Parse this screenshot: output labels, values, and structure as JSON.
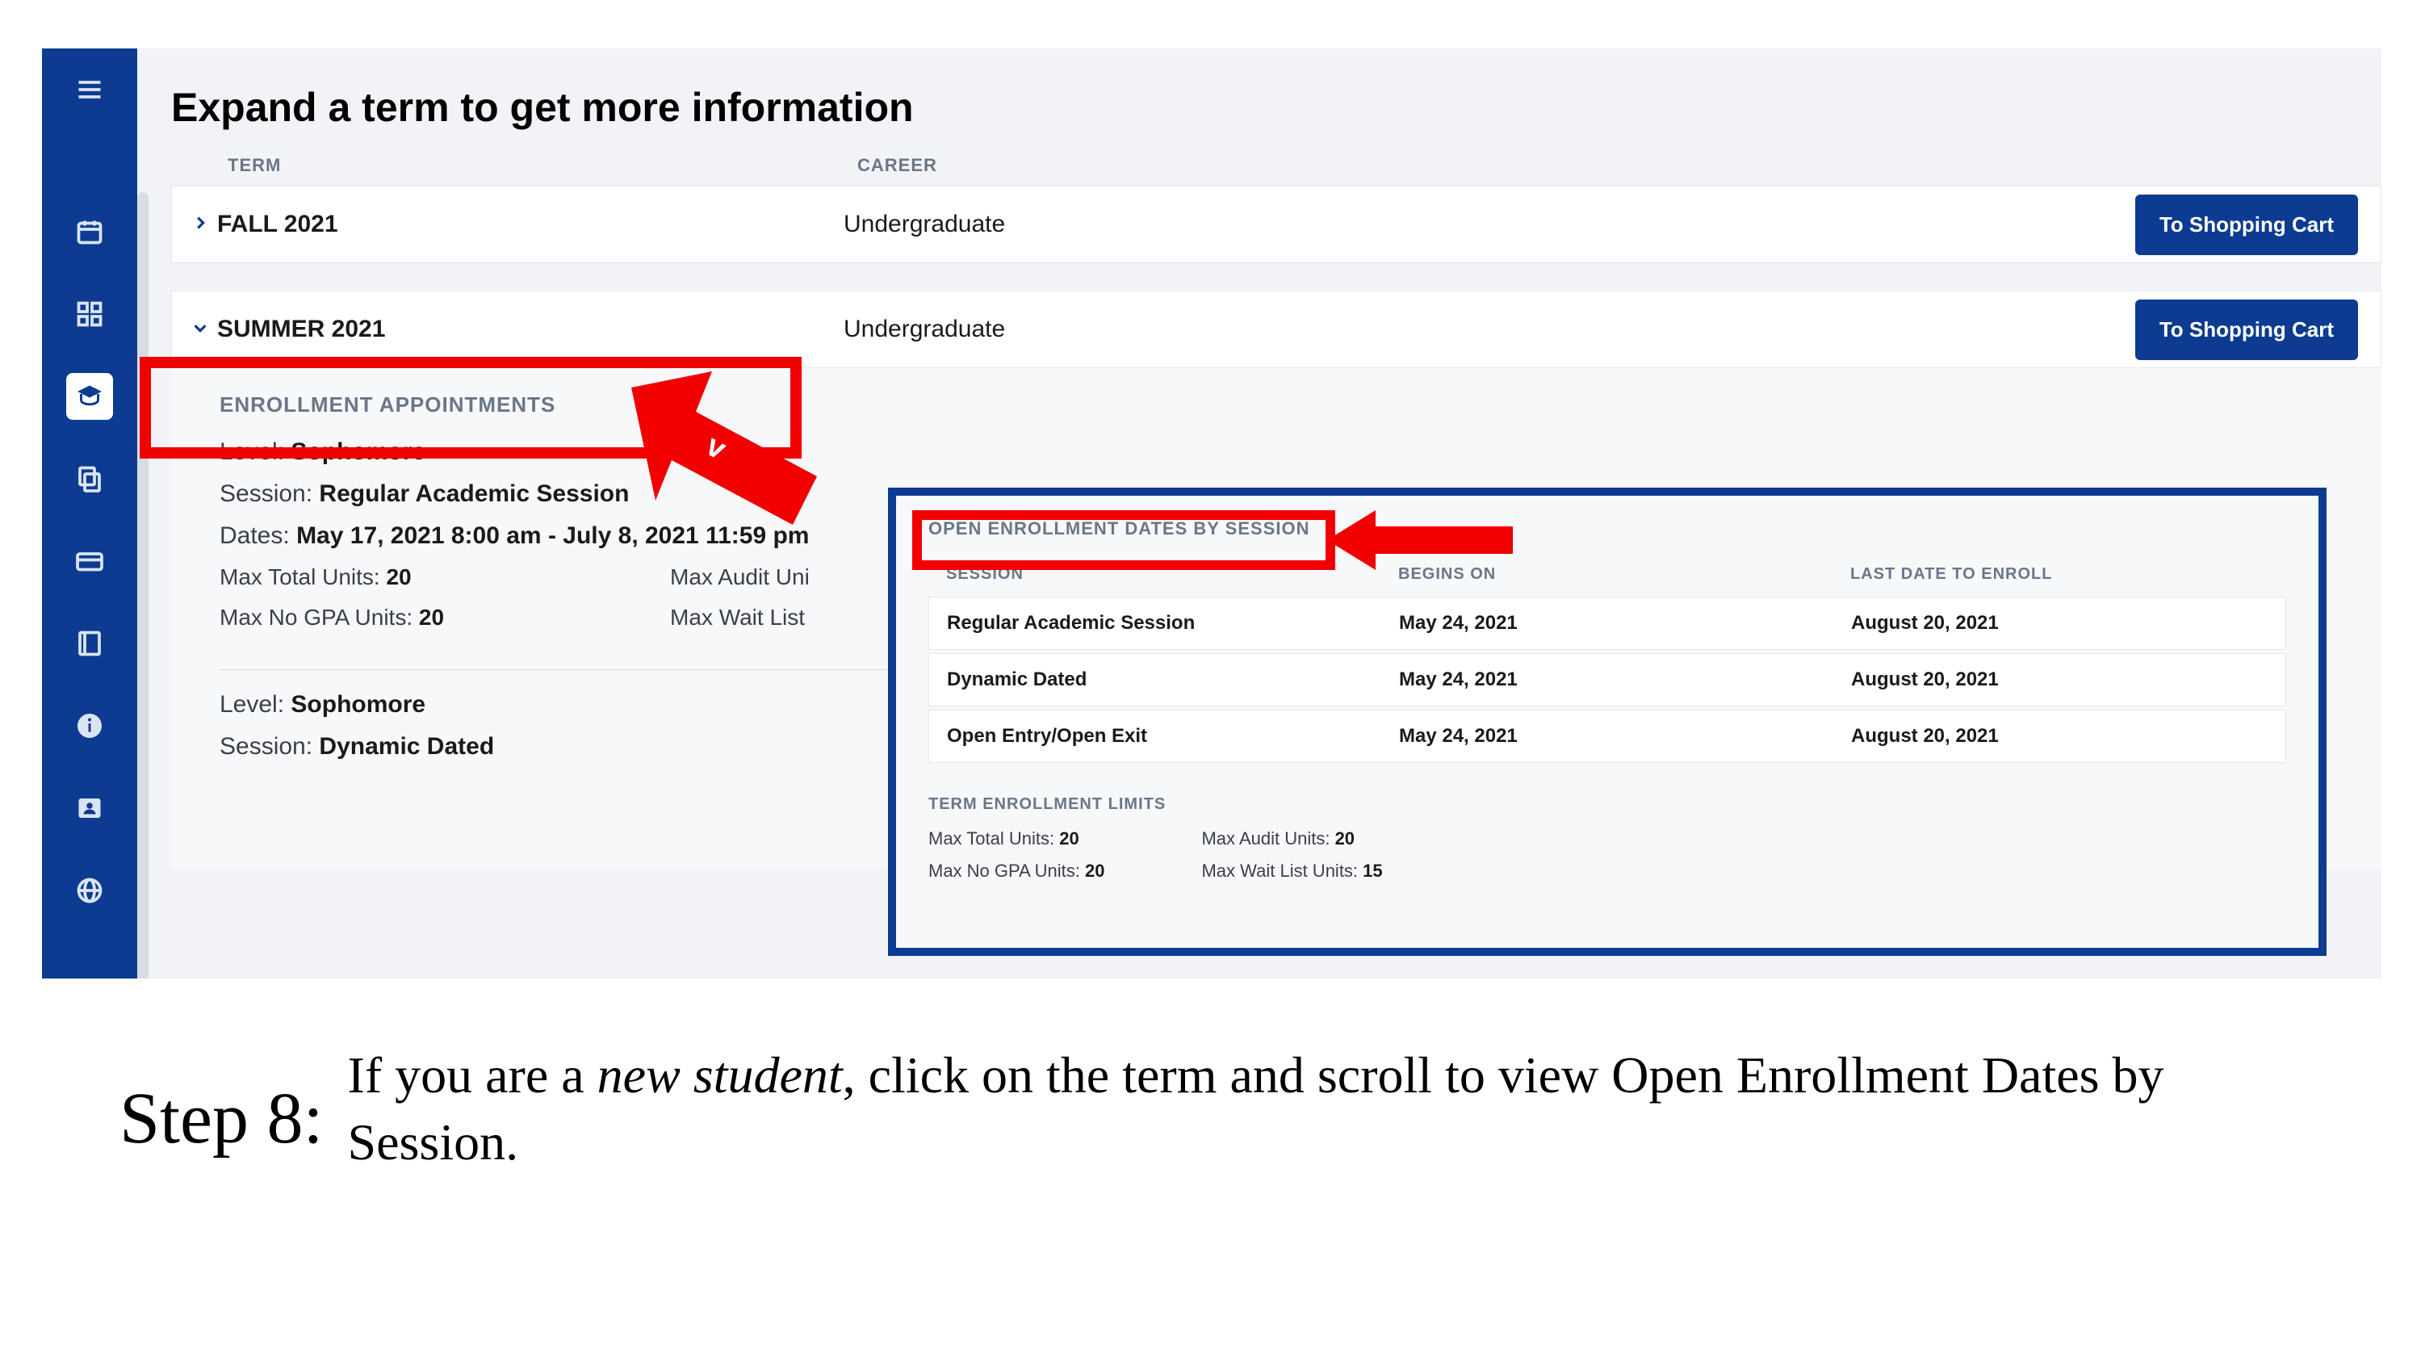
{
  "page": {
    "title": "Expand a term to get more information",
    "columns": {
      "term": "TERM",
      "career": "CAREER"
    }
  },
  "terms": [
    {
      "name": "FALL 2021",
      "career": "Undergraduate",
      "expanded": false,
      "button": "To Shopping Cart"
    },
    {
      "name": "SUMMER 2021",
      "career": "Undergraduate",
      "expanded": true,
      "button": "To Shopping Cart"
    }
  ],
  "enrollment_appointments": {
    "title": "ENROLLMENT APPOINTMENTS",
    "blocks": [
      {
        "level_label": "Level:",
        "level": "Sophomore",
        "session_label": "Session:",
        "session": "Regular Academic Session",
        "dates_label": "Dates:",
        "dates": "May 17, 2021 8:00 am - July 8, 2021 11:59 pm",
        "max_total_label": "Max Total Units:",
        "max_total": "20",
        "max_nogpa_label": "Max No GPA Units:",
        "max_nogpa": "20",
        "max_audit_label_partial": "Max Audit Uni",
        "max_wait_label_partial": "Max Wait List"
      },
      {
        "level_label": "Level:",
        "level": "Sophomore",
        "session_label": "Session:",
        "session": "Dynamic Dated"
      }
    ]
  },
  "open_enrollment": {
    "title": "OPEN ENROLLMENT DATES BY SESSION",
    "columns": {
      "session": "SESSION",
      "begins": "BEGINS ON",
      "last": "LAST DATE TO ENROLL"
    },
    "rows": [
      {
        "session": "Regular Academic Session",
        "begins": "May 24, 2021",
        "last": "August 20, 2021"
      },
      {
        "session": "Dynamic Dated",
        "begins": "May 24, 2021",
        "last": "August 20, 2021"
      },
      {
        "session": "Open Entry/Open Exit",
        "begins": "May 24, 2021",
        "last": "August 20, 2021"
      }
    ]
  },
  "term_limits": {
    "title": "TERM ENROLLMENT LIMITS",
    "items": [
      {
        "label": "Max Total Units:",
        "value": "20"
      },
      {
        "label": "Max No GPA Units:",
        "value": "20"
      },
      {
        "label": "Max Audit Units:",
        "value": "20"
      },
      {
        "label": "Max Wait List Units:",
        "value": "15"
      }
    ]
  },
  "caption": {
    "step": "Step 8:",
    "text_1": "If you are a ",
    "text_em": "new student",
    "text_2": ", click on the term and scroll to view Open Enrollment Dates by Session."
  },
  "icons": {
    "menu": "menu-icon",
    "calendar": "calendar-icon",
    "grid": "grid-icon",
    "graduation": "graduation-cap-icon",
    "copy": "copy-icon",
    "card": "credit-card-icon",
    "book": "book-icon",
    "info": "info-icon",
    "user": "user-card-icon",
    "globe": "globe-icon"
  }
}
